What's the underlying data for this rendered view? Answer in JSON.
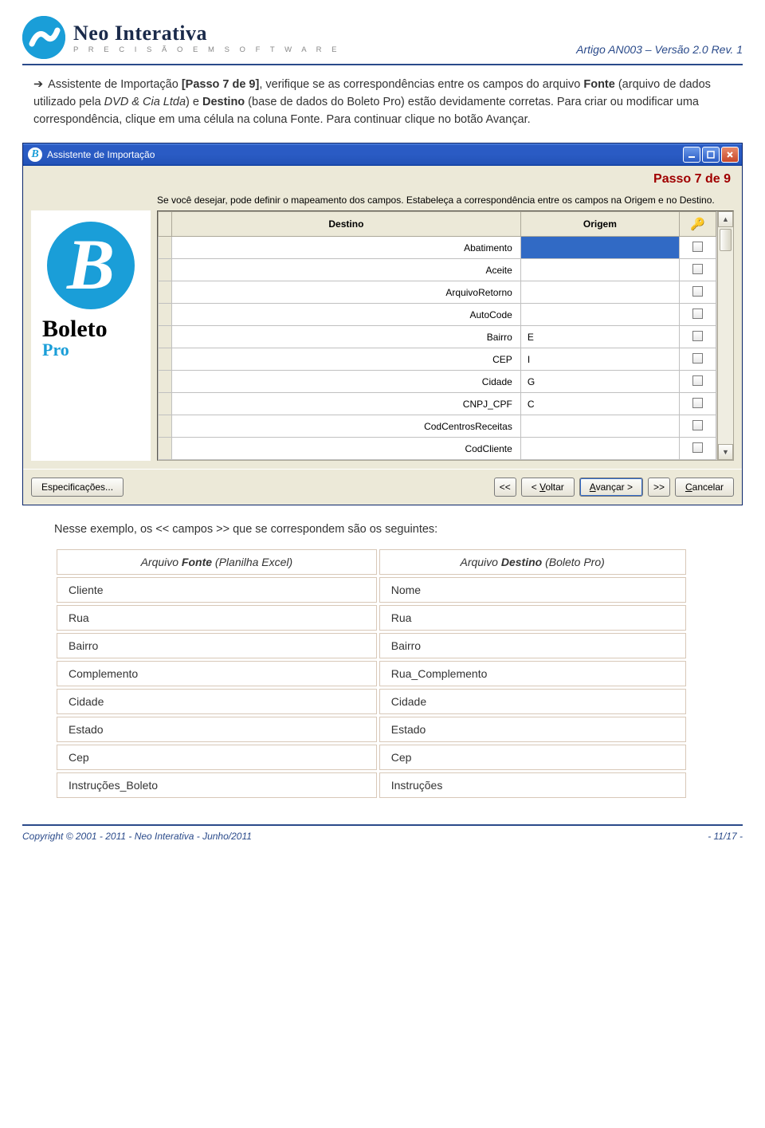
{
  "header": {
    "company_name": "Neo Interativa",
    "tagline": "P R E C I S Ã O   E M   S O F T W A R E",
    "article_ref": "Artigo AN003 – Versão 2.0 Rev. 1"
  },
  "article": {
    "arrow": "➔",
    "p1a": "Assistente de Importação ",
    "p1b": "[Passo 7 de 9]",
    "p1c": ", verifique se as correspondências entre os campos do arquivo ",
    "p1d": "Fonte",
    "p1e": " (arquivo de dados utilizado pela ",
    "p1f": "DVD & Cia Ltda",
    "p1g": ") e ",
    "p1h": "Destino",
    "p1i": " (base de dados do Boleto Pro) estão devidamente corretas. Para criar ou modificar uma correspondência, clique em uma célula na coluna Fonte. Para continuar clique no botão Avançar."
  },
  "win": {
    "title": "Assistente de Importação",
    "step": "Passo 7 de 9",
    "desc": "Se você desejar, pode definir o mapeamento dos campos. Estabeleça a correspondência entre os campos na Origem e no Destino.",
    "brand1": "Boleto",
    "brand2": "Pro",
    "cols": {
      "destino": "Destino",
      "origem": "Origem"
    },
    "rows": [
      {
        "destino": "Abatimento",
        "origem": "",
        "selected": true
      },
      {
        "destino": "Aceite",
        "origem": ""
      },
      {
        "destino": "ArquivoRetorno",
        "origem": ""
      },
      {
        "destino": "AutoCode",
        "origem": ""
      },
      {
        "destino": "Bairro",
        "origem": "E"
      },
      {
        "destino": "CEP",
        "origem": "I"
      },
      {
        "destino": "Cidade",
        "origem": "G"
      },
      {
        "destino": "CNPJ_CPF",
        "origem": "C"
      },
      {
        "destino": "CodCentrosReceitas",
        "origem": ""
      },
      {
        "destino": "CodCliente",
        "origem": ""
      }
    ],
    "buttons": {
      "spec": "Especificações...",
      "first": "<<",
      "back": "< Voltar",
      "next": "Avançar >",
      "last": ">>",
      "cancel": "Cancelar"
    }
  },
  "corr": {
    "intro": "Nesse exemplo, os << campos >> que se correspondem são os seguintes:",
    "h1a": "Arquivo ",
    "h1b": "Fonte",
    "h1c": " (Planilha Excel)",
    "h2a": "Arquivo ",
    "h2b": "Destino",
    "h2c": " (Boleto Pro)",
    "rows": [
      [
        "Cliente",
        "Nome"
      ],
      [
        "Rua",
        "Rua"
      ],
      [
        "Bairro",
        "Bairro"
      ],
      [
        "Complemento",
        "Rua_Complemento"
      ],
      [
        "Cidade",
        "Cidade"
      ],
      [
        "Estado",
        "Estado"
      ],
      [
        "Cep",
        "Cep"
      ],
      [
        "Instruções_Boleto",
        "Instruções"
      ]
    ]
  },
  "footer": {
    "copyright": "Copyright © 2001 - 2011 - Neo Interativa - Junho/2011",
    "page": "- 11/17 -"
  }
}
